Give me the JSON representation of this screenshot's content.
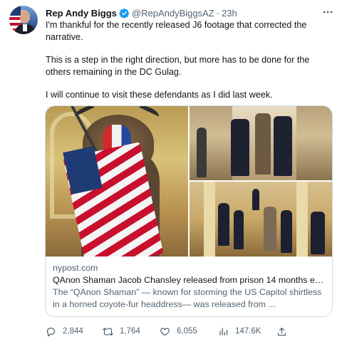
{
  "tweet": {
    "author_name": "Rep Andy Biggs",
    "handle": "@RepAndyBiggsAZ",
    "separator": "·",
    "time": "23h",
    "more_icon": "more-horizontal-icon",
    "verified_icon": "verified-badge-icon",
    "paragraphs": [
      "I'm thankful for the recently released J6 footage that corrected the narrative.",
      "This is a step in the right direction, but more has to be done for the others remaining in the DC Gulag.",
      "I will continue to visit these defendants as I did last week."
    ]
  },
  "card": {
    "domain": "nypost.com",
    "title": "QAnon Shaman Jacob Chansley released from prison 14 months earl...",
    "description": "The “QAnon Shaman” — known for storming the US Capitol shirtless in a horned coyote-fur headdress— was released from ..."
  },
  "actions": {
    "replies": "2,844",
    "retweets": "1,764",
    "likes": "6,055",
    "views": "147.6K"
  },
  "colors": {
    "text": "#0f1419",
    "secondary": "#536471",
    "border": "#cfd9de",
    "verified": "#1d9bf0"
  }
}
